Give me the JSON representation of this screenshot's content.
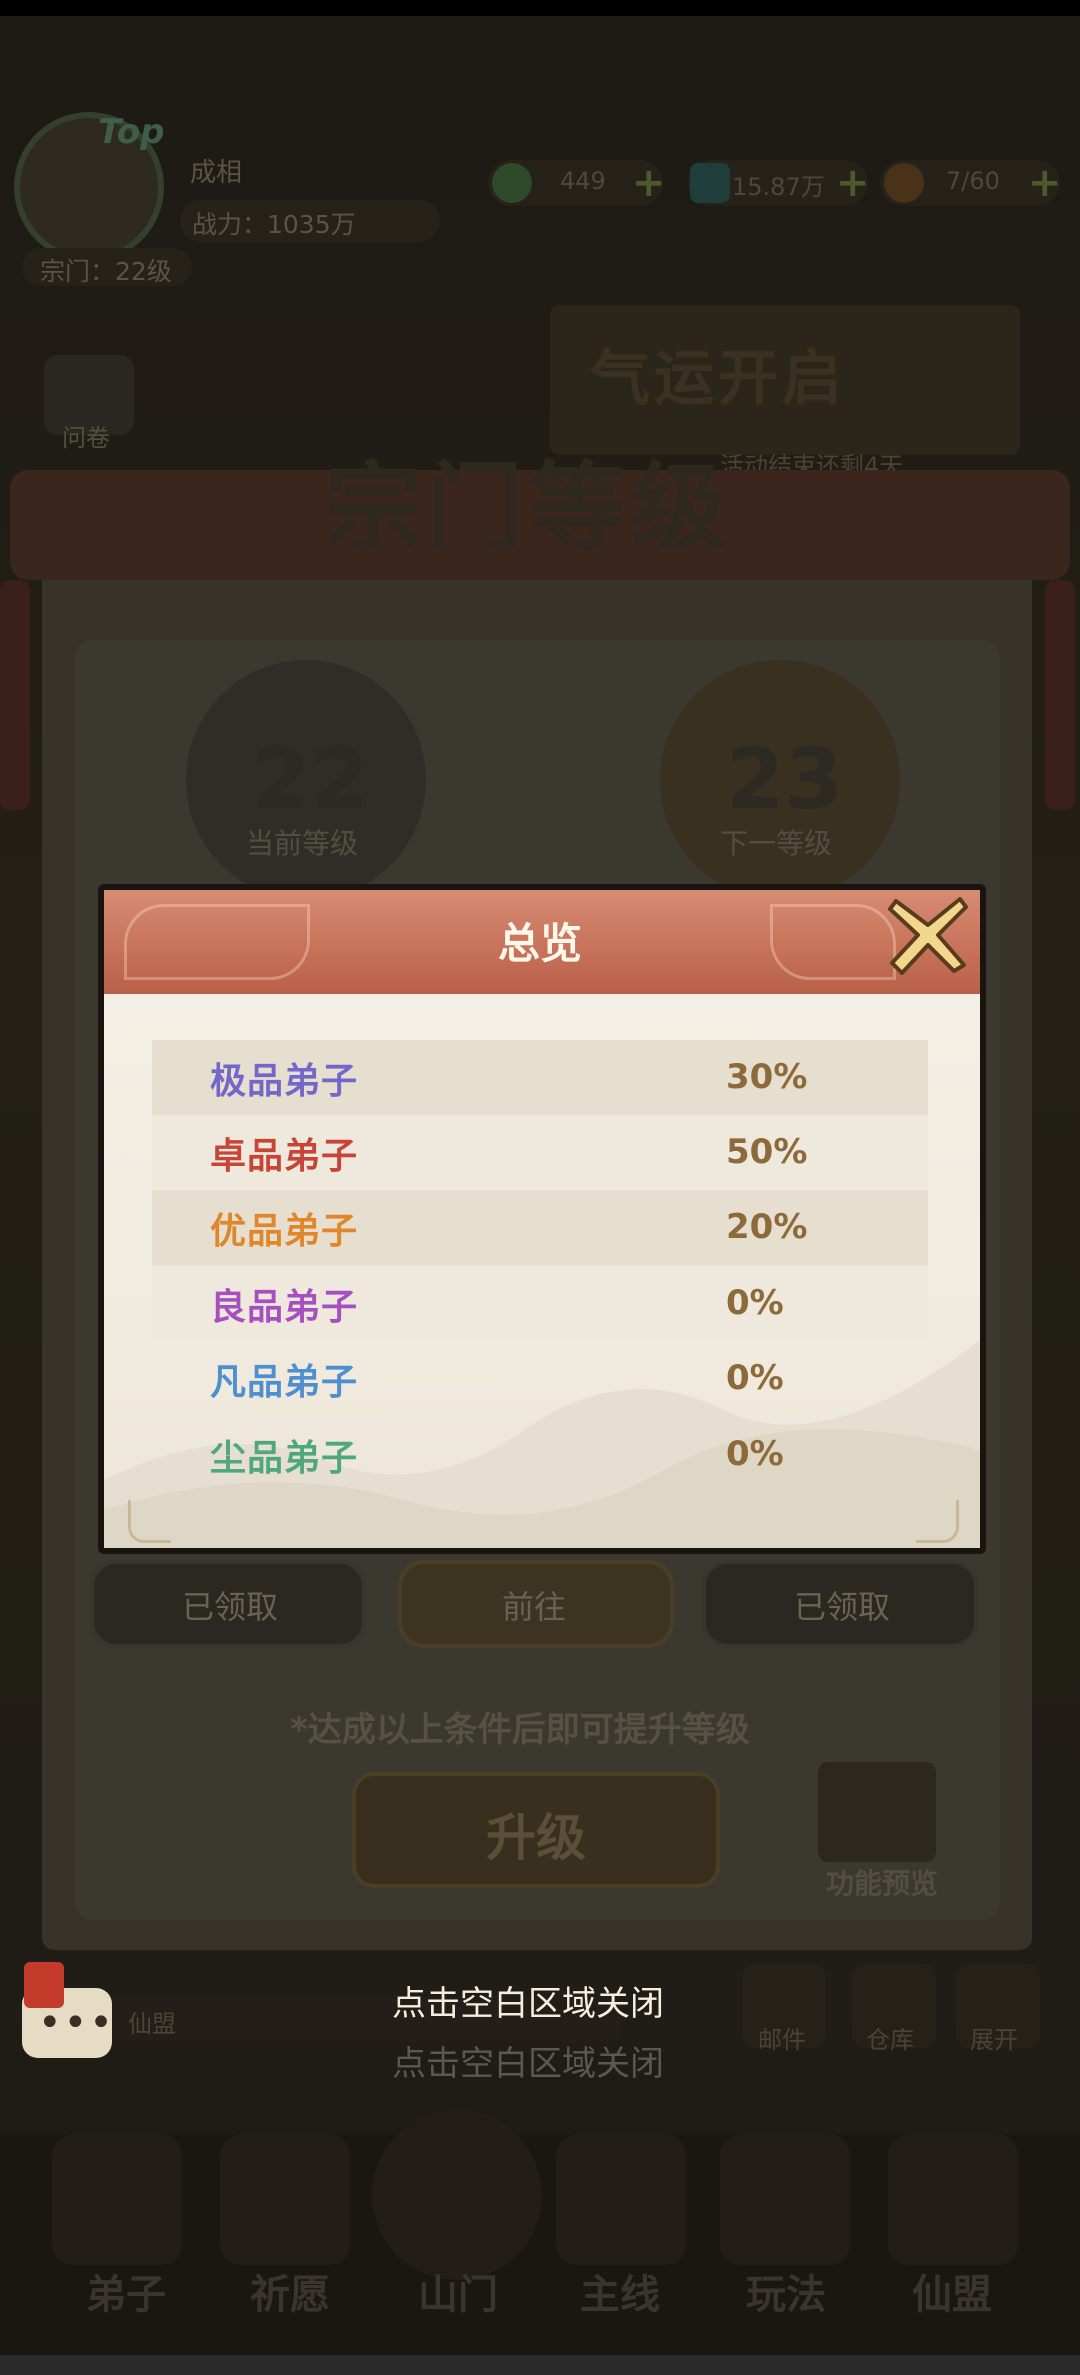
{
  "player": {
    "top_tag": "Top",
    "name": "成相",
    "power": "战力：1035万",
    "sect_level": "宗门：22级"
  },
  "resources": [
    {
      "icon": "jade-icon",
      "value": "449"
    },
    {
      "icon": "spirit-stone-icon",
      "value": "15.87万"
    },
    {
      "icon": "peach-icon",
      "value": "7/60"
    }
  ],
  "side_left": {
    "survey_label": "问卷"
  },
  "event_banner": {
    "title": "气运开启",
    "subtitle": "活动结束还剩4天"
  },
  "sect_level_card": {
    "title": "宗门等级",
    "current_level": "22",
    "current_label": "当前等级",
    "next_level": "23",
    "next_label": "下一等级",
    "task_buttons": [
      "已领取",
      "前往",
      "已领取"
    ],
    "condition_note": "*达成以上条件后即可提升等级",
    "upgrade_label": "升级",
    "preview_label": "功能预览"
  },
  "overview_popup": {
    "title": "总览",
    "rows": [
      {
        "name": "极品弟子",
        "value": "30%",
        "color": "#7368c9"
      },
      {
        "name": "卓品弟子",
        "value": "50%",
        "color": "#c84436"
      },
      {
        "name": "优品弟子",
        "value": "20%",
        "color": "#e0862b"
      },
      {
        "name": "良品弟子",
        "value": "0%",
        "color": "#a54fc1"
      },
      {
        "name": "凡品弟子",
        "value": "0%",
        "color": "#4e8fcf"
      },
      {
        "name": "尘品弟子",
        "value": "0%",
        "color": "#4fa87a"
      }
    ]
  },
  "chat": {
    "channel": "仙盟"
  },
  "side_right": {
    "labels": [
      "邮件",
      "仓库",
      "展开"
    ]
  },
  "close_tip": "点击空白区域关闭",
  "close_tip_echo": "点击空白区域关闭",
  "nav": [
    "弟子",
    "祈愿",
    "山门",
    "主线",
    "玩法",
    "仙盟"
  ]
}
